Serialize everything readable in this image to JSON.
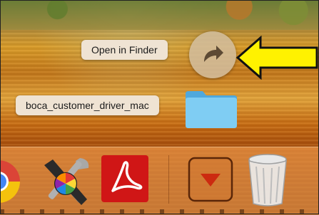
{
  "stack_popover": {
    "open_in_finder_label": "Open in Finder",
    "folder_name": "boca_customer_driver_mac"
  },
  "dock": {
    "items": [
      {
        "icon": "chrome-icon"
      },
      {
        "icon": "colorsync-utility-icon"
      },
      {
        "icon": "acrobat-reader-icon"
      },
      {
        "icon": "downloads-stack-icon"
      },
      {
        "icon": "trash-icon"
      }
    ]
  },
  "colors": {
    "callout_arrow": "#fff200",
    "tooltip_bg": "#efe3d3",
    "folder_blue": "#6cc3ee",
    "acrobat_red": "#d01616",
    "downloads_arrow": "#cc2a10"
  }
}
